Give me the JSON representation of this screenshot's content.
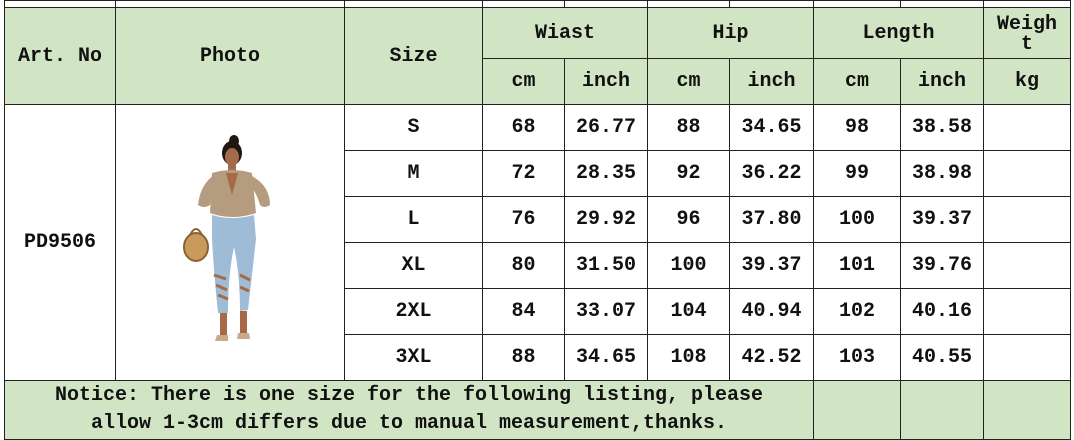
{
  "header": {
    "art_no": "Art. No",
    "photo": "Photo",
    "size": "Size",
    "waist": "Wiast",
    "hip": "Hip",
    "length": "Length",
    "weight": "Weigh",
    "weight_cut": "t",
    "unit_cm": "cm",
    "unit_inch": "inch",
    "unit_kg": "kg"
  },
  "product": {
    "art_no": "PD9506",
    "photo_icon": "model-photo"
  },
  "rows": [
    {
      "size": "S",
      "waist_cm": "68",
      "waist_inch": "26.77",
      "hip_cm": "88",
      "hip_inch": "34.65",
      "length_cm": "98",
      "length_inch": "38.58",
      "weight": ""
    },
    {
      "size": "M",
      "waist_cm": "72",
      "waist_inch": "28.35",
      "hip_cm": "92",
      "hip_inch": "36.22",
      "length_cm": "99",
      "length_inch": "38.98",
      "weight": ""
    },
    {
      "size": "L",
      "waist_cm": "76",
      "waist_inch": "29.92",
      "hip_cm": "96",
      "hip_inch": "37.80",
      "length_cm": "100",
      "length_inch": "39.37",
      "weight": ""
    },
    {
      "size": "XL",
      "waist_cm": "80",
      "waist_inch": "31.50",
      "hip_cm": "100",
      "hip_inch": "39.37",
      "length_cm": "101",
      "length_inch": "39.76",
      "weight": ""
    },
    {
      "size": "2XL",
      "waist_cm": "84",
      "waist_inch": "33.07",
      "hip_cm": "104",
      "hip_inch": "40.94",
      "length_cm": "102",
      "length_inch": "40.16",
      "weight": ""
    },
    {
      "size": "3XL",
      "waist_cm": "88",
      "waist_inch": "34.65",
      "hip_cm": "108",
      "hip_inch": "42.52",
      "length_cm": "103",
      "length_inch": "40.55",
      "weight": ""
    }
  ],
  "notice": {
    "line1": "Notice: There is one size for the following listing, please",
    "line2": "allow 1-3cm differs due to manual measurement,thanks."
  },
  "colors": {
    "header_bg": "#d1e5c4",
    "border": "#222222"
  }
}
